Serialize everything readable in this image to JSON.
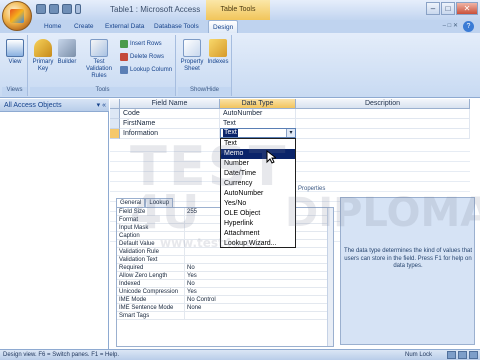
{
  "window": {
    "app_title": "Table1 : Microsoft Access",
    "context_tab_title": "Table Tools"
  },
  "tabs": [
    "Home",
    "Create",
    "External Data",
    "Database Tools",
    "Design"
  ],
  "ribbon": {
    "views": {
      "view_label": "View",
      "group_label": "Views"
    },
    "tools": {
      "primary_key": "Primary Key",
      "builder": "Builder",
      "test_validation": "Test Validation Rules",
      "insert_rows": "Insert Rows",
      "delete_rows": "Delete Rows",
      "lookup_column": "Lookup Column",
      "group_label": "Tools"
    },
    "show_hide": {
      "property_sheet": "Property Sheet",
      "indexes": "Indexes",
      "group_label": "Show/Hide"
    }
  },
  "nav_pane": {
    "title": "All Access Objects"
  },
  "design_grid": {
    "headers": [
      "Field Name",
      "Data Type",
      "Description"
    ],
    "rows": [
      {
        "field": "Code",
        "type": "AutoNumber"
      },
      {
        "field": "FirstName",
        "type": "Text"
      },
      {
        "field": "Information",
        "type": "Text"
      }
    ]
  },
  "dropdown": {
    "options": [
      "Text",
      "Memo",
      "Number",
      "Date/Time",
      "Currency",
      "AutoNumber",
      "Yes/No",
      "OLE Object",
      "Hyperlink",
      "Attachment",
      "Lookup Wizard..."
    ],
    "highlighted_index": 1
  },
  "field_properties": {
    "title": "Properties",
    "tabs": [
      "General",
      "Lookup"
    ],
    "rows": [
      {
        "label": "Field Size",
        "value": "255"
      },
      {
        "label": "Format",
        "value": ""
      },
      {
        "label": "Input Mask",
        "value": ""
      },
      {
        "label": "Caption",
        "value": ""
      },
      {
        "label": "Default Value",
        "value": ""
      },
      {
        "label": "Validation Rule",
        "value": ""
      },
      {
        "label": "Validation Text",
        "value": ""
      },
      {
        "label": "Required",
        "value": "No"
      },
      {
        "label": "Allow Zero Length",
        "value": "Yes"
      },
      {
        "label": "Indexed",
        "value": "No"
      },
      {
        "label": "Unicode Compression",
        "value": "Yes"
      },
      {
        "label": "IME Mode",
        "value": "No Control"
      },
      {
        "label": "IME Sentence Mode",
        "value": "None"
      },
      {
        "label": "Smart Tags",
        "value": ""
      }
    ],
    "help_text": "The data type determines the kind of values that users can store in the field. Press F1 for help on data types."
  },
  "status_bar": {
    "left": "Design view.  F6 = Switch panes.  F1 = Help.",
    "num_lock": "Num Lock"
  },
  "watermark": {
    "brand": "TEST",
    "brand2": "4U",
    "word": "DIPLOMA",
    "url": "www.test4u.eu"
  },
  "colors": {
    "accent": "#0a246a",
    "context_tab": "#f1c55a",
    "ribbon": "#c8daf2"
  }
}
